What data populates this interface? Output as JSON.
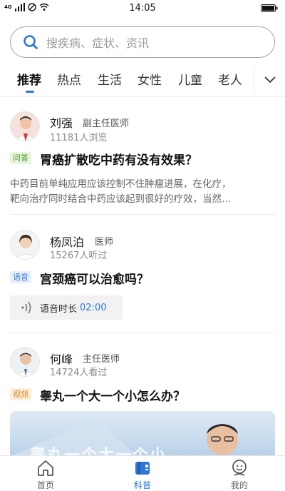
{
  "status_bar": {
    "network": "4G",
    "time": "14:05"
  },
  "search": {
    "placeholder": "搜疾病、症状、资讯"
  },
  "tabs": [
    {
      "label": "推荐",
      "active": true
    },
    {
      "label": "热点"
    },
    {
      "label": "生活"
    },
    {
      "label": "女性"
    },
    {
      "label": "儿童"
    },
    {
      "label": "老人"
    }
  ],
  "feed": [
    {
      "doctor_name": "刘强",
      "doctor_title": "副主任医师",
      "stat": "11181人浏览",
      "badge": "问答",
      "title": "胃癌扩散吃中药有没有效果？",
      "excerpt_lines": [
        "中药目前单纯应用应该控制不住肿瘤进展，在化疗，",
        "靶向治疗同时结合中药应该起到很好的疗效，当然…"
      ]
    },
    {
      "doctor_name": "杨凤泊",
      "doctor_title": "医师",
      "stat": "15267人听过",
      "badge": "语音",
      "title": "宫颈癌可以治愈吗？",
      "voice_label": "语音时长",
      "voice_duration": "02:00"
    },
    {
      "doctor_name": "何峰",
      "doctor_title": "主任医师",
      "stat": "14724人看过",
      "badge": "视频",
      "title": "睾丸一个大一个小怎么办？",
      "video_overlay": "睾丸一个大一个小"
    }
  ],
  "bottom_nav": [
    {
      "label": "首页",
      "icon": "home-icon"
    },
    {
      "label": "科普",
      "icon": "book-icon",
      "active": true
    },
    {
      "label": "我的",
      "icon": "profile-icon"
    }
  ],
  "colors": {
    "accent": "#2f76d8"
  }
}
